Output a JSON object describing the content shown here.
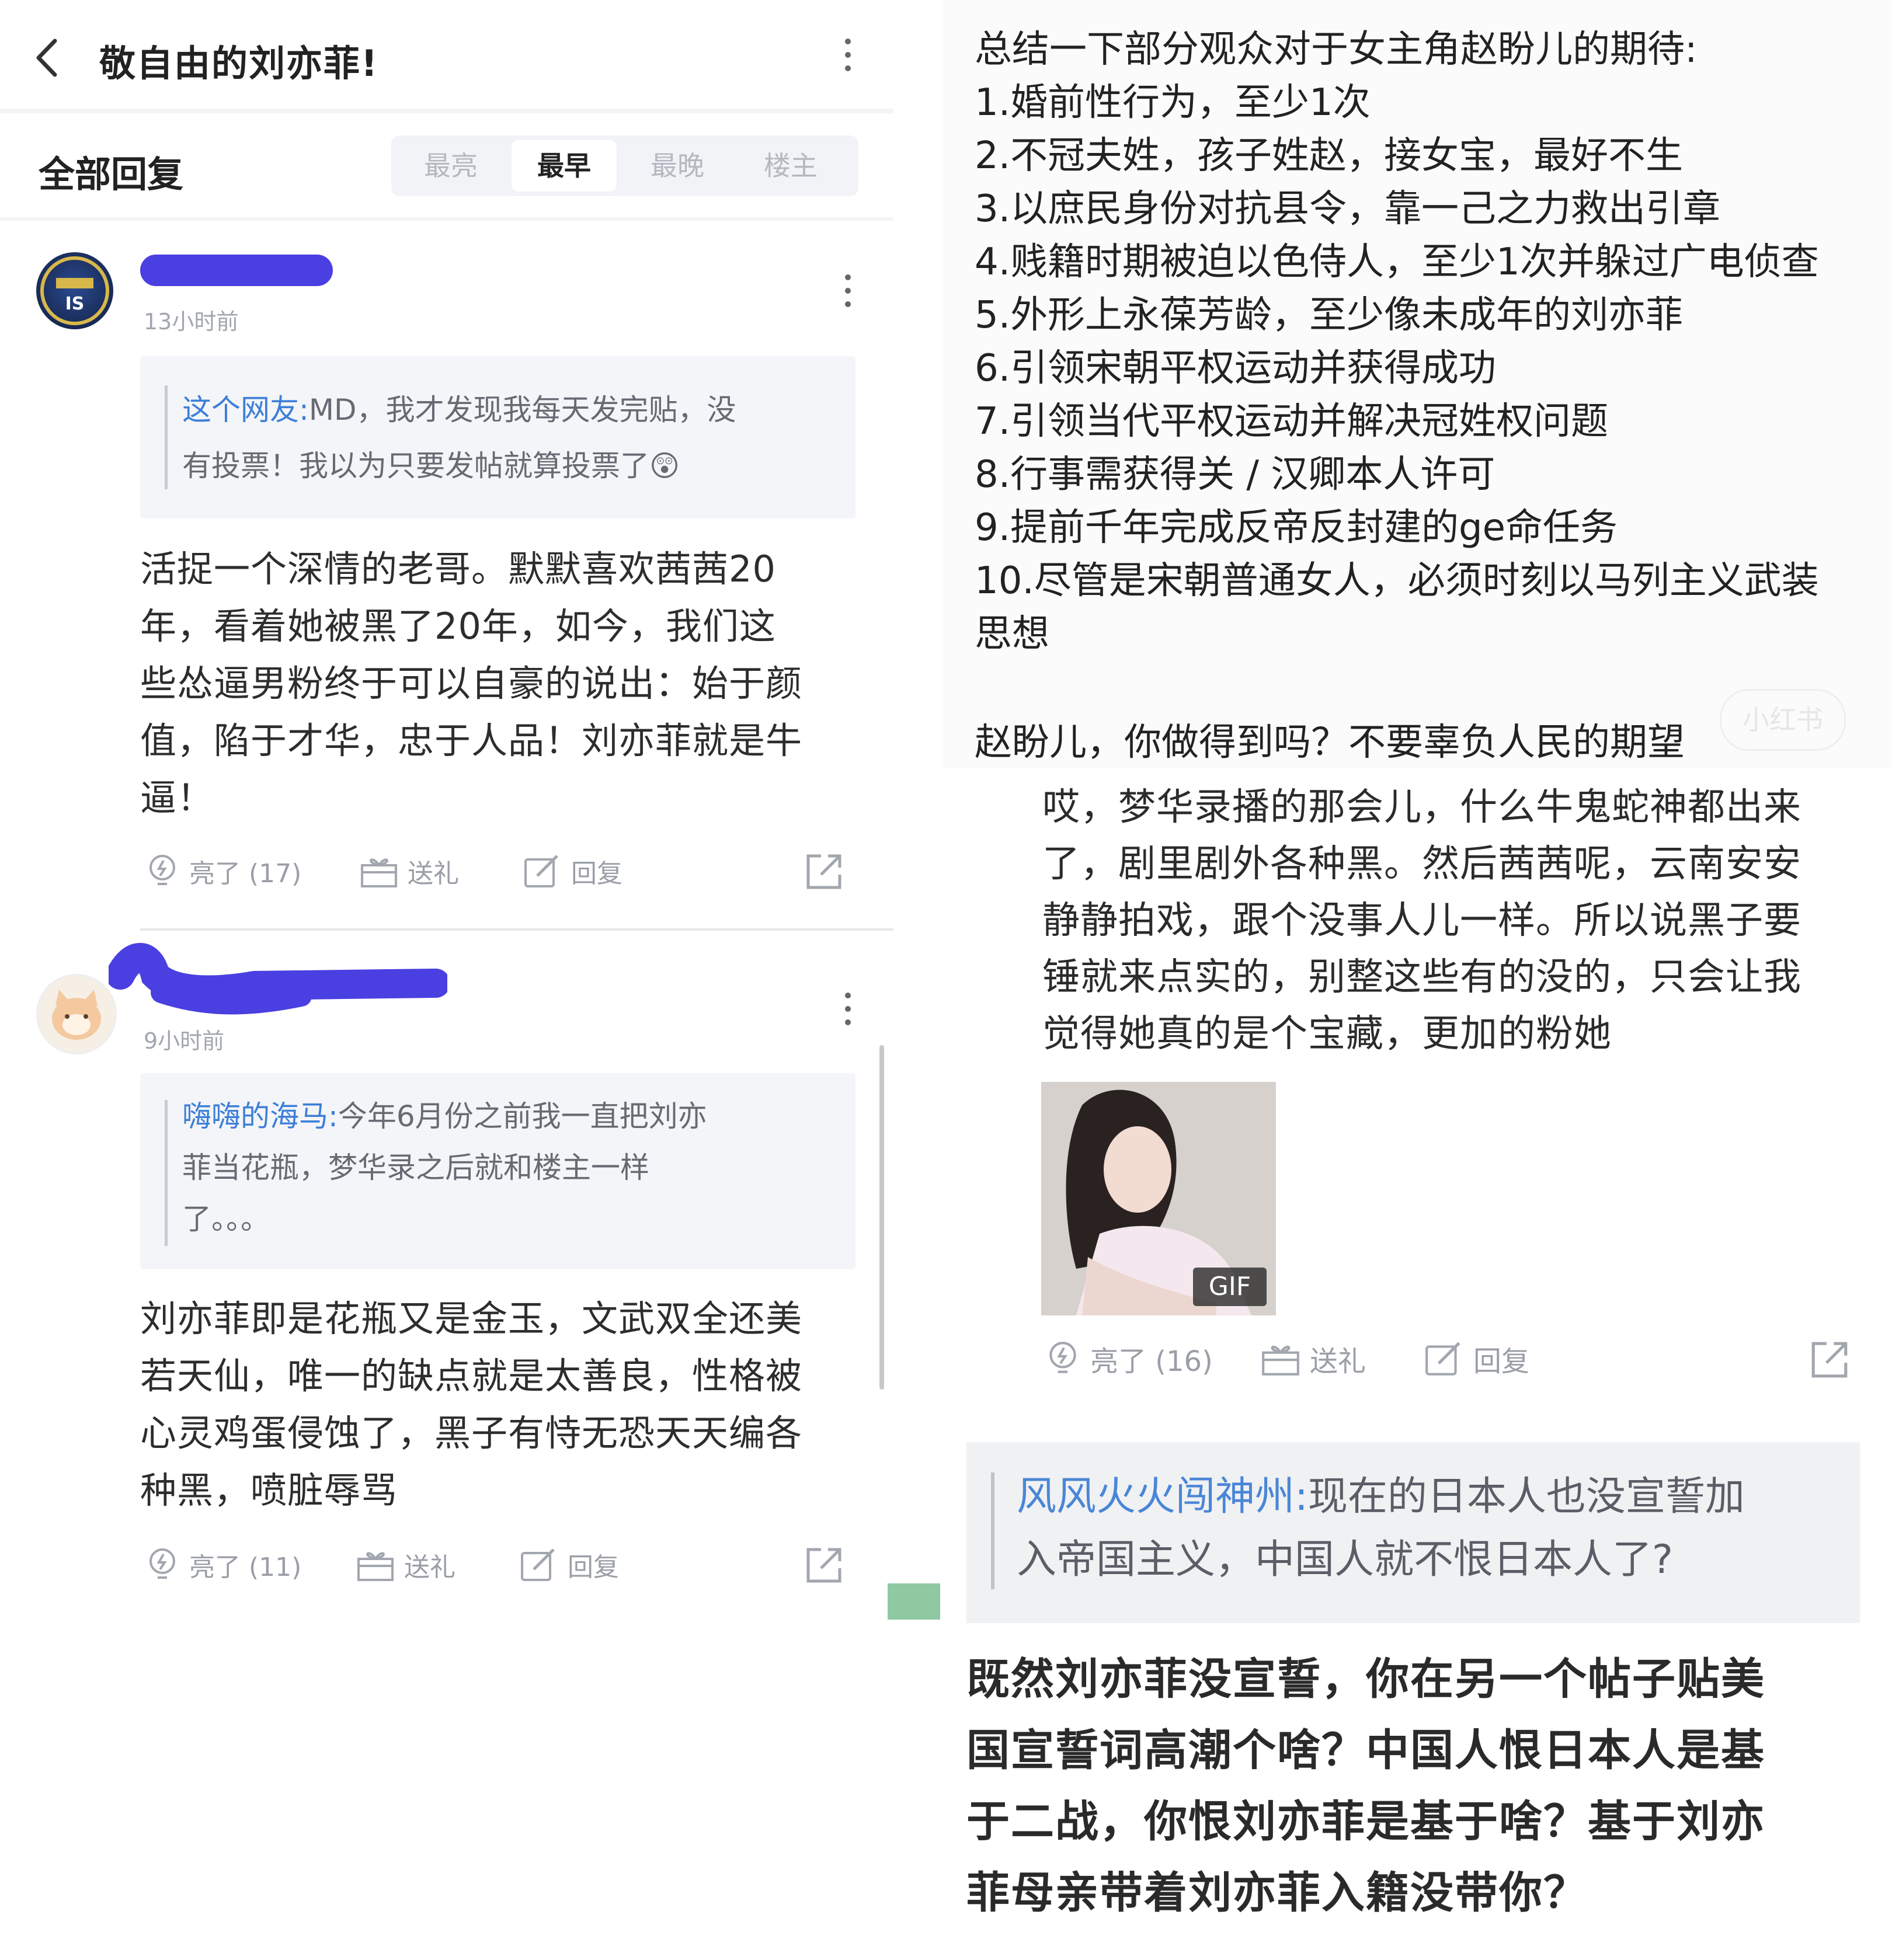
{
  "left": {
    "header": {
      "title": "敬自由的刘亦菲!"
    },
    "section": {
      "title": "全部回复",
      "sort_tabs": [
        "最亮",
        "最早",
        "最晚",
        "楼主"
      ],
      "active_tab": "最早"
    },
    "posts": [
      {
        "avatar_text": "IS",
        "time": "13小时前",
        "quote_name": "这个网友:",
        "quote_lines": [
          "MD，我才发现我每天发完贴，没",
          "有投票！我以为只要发帖就算投票了"
        ],
        "quote_emoji": "😲",
        "body_lines": [
          "活捉一个深情的老哥。默默喜欢茜茜20",
          "年，看着她被黑了20年，如今，我们这",
          "些怂逼男粉终于可以自豪的说出：始于颜",
          "值，陷于才华，忠于人品！刘亦菲就是牛",
          "逼！"
        ],
        "actions": {
          "like": "亮了 (17)",
          "gift": "送礼",
          "reply": "回复"
        }
      },
      {
        "time": "9小时前",
        "quote_name": "嗨嗨的海马:",
        "quote_lines": [
          "今年6月份之前我一直把刘亦",
          "菲当花瓶，梦华录之后就和楼主一样",
          "了。。。"
        ],
        "body_lines": [
          "刘亦菲即是花瓶又是金玉，文武双全还美",
          "若天仙，唯一的缺点就是太善良，性格被",
          "心灵鸡蛋侵蚀了，黑子有恃无恐天天编各",
          "种黑，喷脏辱骂"
        ],
        "actions": {
          "like": "亮了 (11)",
          "gift": "送礼",
          "reply": "回复"
        }
      }
    ]
  },
  "right_top": {
    "lines": [
      "总结一下部分观众对于女主角赵盼儿的期待:",
      "1.婚前性行为，至少1次",
      "2.不冠夫姓，孩子姓赵，接女宝，最好不生",
      "3.以庶民身份对抗县令，靠一己之力救出引章",
      "4.贱籍时期被迫以色侍人，至少1次并躲过广电侦查",
      "5.外形上永葆芳龄，至少像未成年的刘亦菲",
      "6.引领宋朝平权运动并获得成功",
      "7.引领当代平权运动并解决冠姓权问题",
      "8.行事需获得关 / 汉卿本人许可",
      "9.提前千年完成反帝反封建的ge命任务",
      "10.尽管是宋朝普通女人，必须时刻以马列主义武装",
      "思想"
    ],
    "closing": "赵盼儿，你做得到吗？不要辜负人民的期望",
    "watermark": "小红书"
  },
  "right_mid": {
    "body_lines": [
      "哎，梦华录播的那会儿，什么牛鬼蛇神都出来",
      "了，剧里剧外各种黑。然后茜茜呢，云南安安",
      "静静拍戏，跟个没事人儿一样。所以说黑子要",
      "锤就来点实的，别整这些有的没的，只会让我",
      "觉得她真的是个宝藏，更加的粉她"
    ],
    "gif_label": "GIF",
    "actions": {
      "like": "亮了 (16)",
      "gift": "送礼",
      "reply": "回复"
    }
  },
  "right_bottom": {
    "quote_name": "风风火火闯神州:",
    "quote_lines": [
      "现在的日本人也没宣誓加",
      "入帝国主义，中国人就不恨日本人了?"
    ],
    "body_lines": [
      "既然刘亦菲没宣誓，你在另一个帖子贴美",
      "国宣誓词高潮个啥？中国人恨日本人是基",
      "于二战，你恨刘亦菲是基于啥？基于刘亦",
      "菲母亲带着刘亦菲入籍没带你？"
    ]
  }
}
